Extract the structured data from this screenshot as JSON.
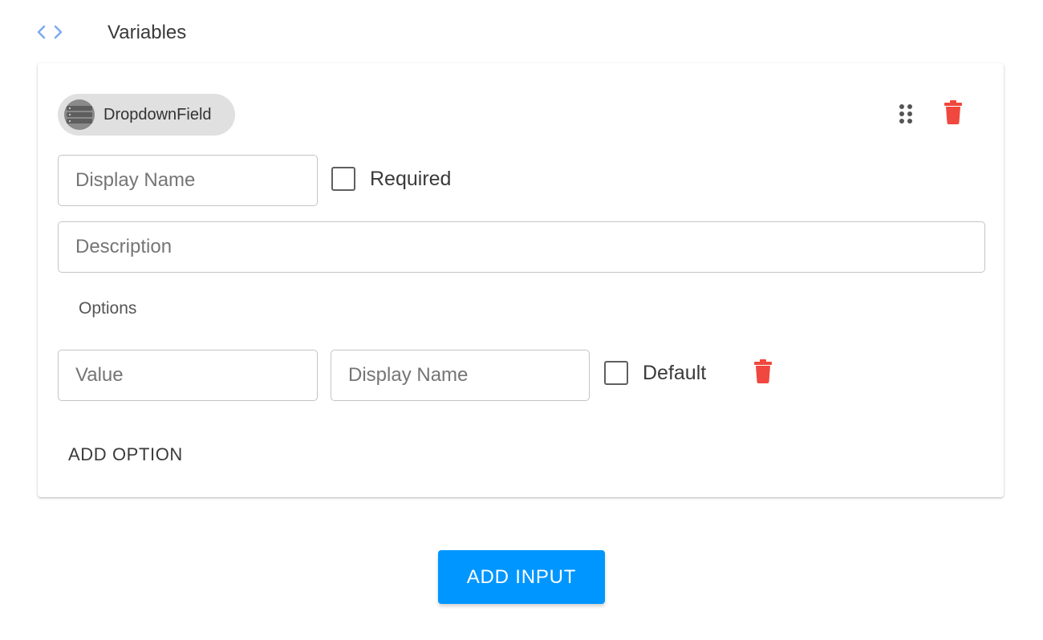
{
  "header": {
    "icon": "code-brackets-icon",
    "title": "Variables",
    "icon_color": "#7faaf0"
  },
  "field_card": {
    "chip": {
      "icon": "dropdown-list-icon",
      "label": "DropdownField"
    },
    "drag_icon": "drag-dots-icon",
    "delete_icon": "trash-icon",
    "delete_color": "#f0473e",
    "display_name": {
      "value": "",
      "placeholder": "Display Name"
    },
    "required": {
      "label": "Required",
      "checked": false
    },
    "description": {
      "value": "",
      "placeholder": "Description"
    },
    "options_heading": "Options",
    "options": [
      {
        "value": {
          "value": "",
          "placeholder": "Value"
        },
        "display_name": {
          "value": "",
          "placeholder": "Display Name"
        },
        "default": {
          "label": "Default",
          "checked": false
        },
        "delete_icon": "trash-icon"
      }
    ],
    "add_option_label": "ADD OPTION"
  },
  "add_input": {
    "label": "ADD INPUT",
    "color": "#0096ff"
  }
}
